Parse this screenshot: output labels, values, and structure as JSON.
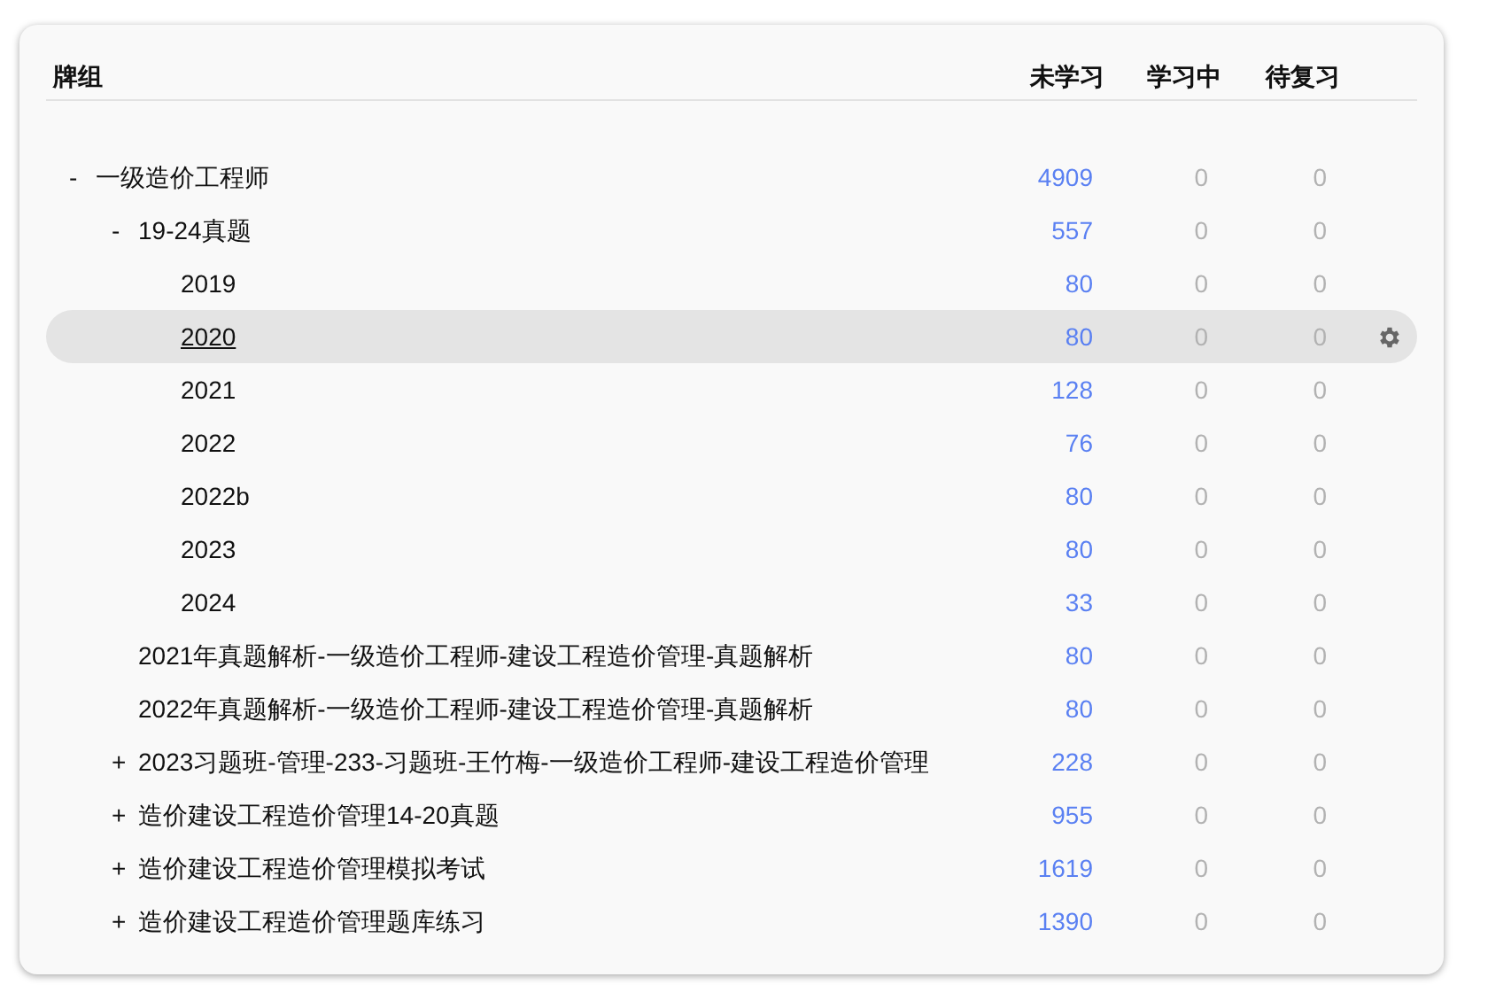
{
  "header": {
    "deck": "牌组",
    "new": "未学习",
    "learning": "学习中",
    "due": "待复习"
  },
  "decks": [
    {
      "toggle": "-",
      "name": "一级造价工程师",
      "new": "4909",
      "learning": "0",
      "due": "0",
      "selected": false,
      "children": [
        {
          "toggle": "-",
          "name": "19-24真题",
          "new": "557",
          "learning": "0",
          "due": "0",
          "selected": false,
          "children": [
            {
              "name": "2019",
              "new": "80",
              "learning": "0",
              "due": "0",
              "selected": false
            },
            {
              "name": "2020",
              "new": "80",
              "learning": "0",
              "due": "0",
              "selected": true
            },
            {
              "name": "2021",
              "new": "128",
              "learning": "0",
              "due": "0",
              "selected": false
            },
            {
              "name": "2022",
              "new": "76",
              "learning": "0",
              "due": "0",
              "selected": false
            },
            {
              "name": "2022b",
              "new": "80",
              "learning": "0",
              "due": "0",
              "selected": false
            },
            {
              "name": "2023",
              "new": "80",
              "learning": "0",
              "due": "0",
              "selected": false
            },
            {
              "name": "2024",
              "new": "33",
              "learning": "0",
              "due": "0",
              "selected": false
            }
          ]
        },
        {
          "name": "2021年真题解析-一级造价工程师-建设工程造价管理-真题解析",
          "new": "80",
          "learning": "0",
          "due": "0",
          "selected": false
        },
        {
          "name": "2022年真题解析-一级造价工程师-建设工程造价管理-真题解析",
          "new": "80",
          "learning": "0",
          "due": "0",
          "selected": false
        },
        {
          "toggle": "+",
          "name": "2023习题班-管理-233-习题班-王竹梅-一级造价工程师-建设工程造价管理",
          "new": "228",
          "learning": "0",
          "due": "0",
          "selected": false
        },
        {
          "toggle": "+",
          "name": "造价建设工程造价管理14-20真题",
          "new": "955",
          "learning": "0",
          "due": "0",
          "selected": false
        },
        {
          "toggle": "+",
          "name": "造价建设工程造价管理模拟考试",
          "new": "1619",
          "learning": "0",
          "due": "0",
          "selected": false
        },
        {
          "toggle": "+",
          "name": "造价建设工程造价管理题库练习",
          "new": "1390",
          "learning": "0",
          "due": "0",
          "selected": false
        }
      ]
    }
  ]
}
